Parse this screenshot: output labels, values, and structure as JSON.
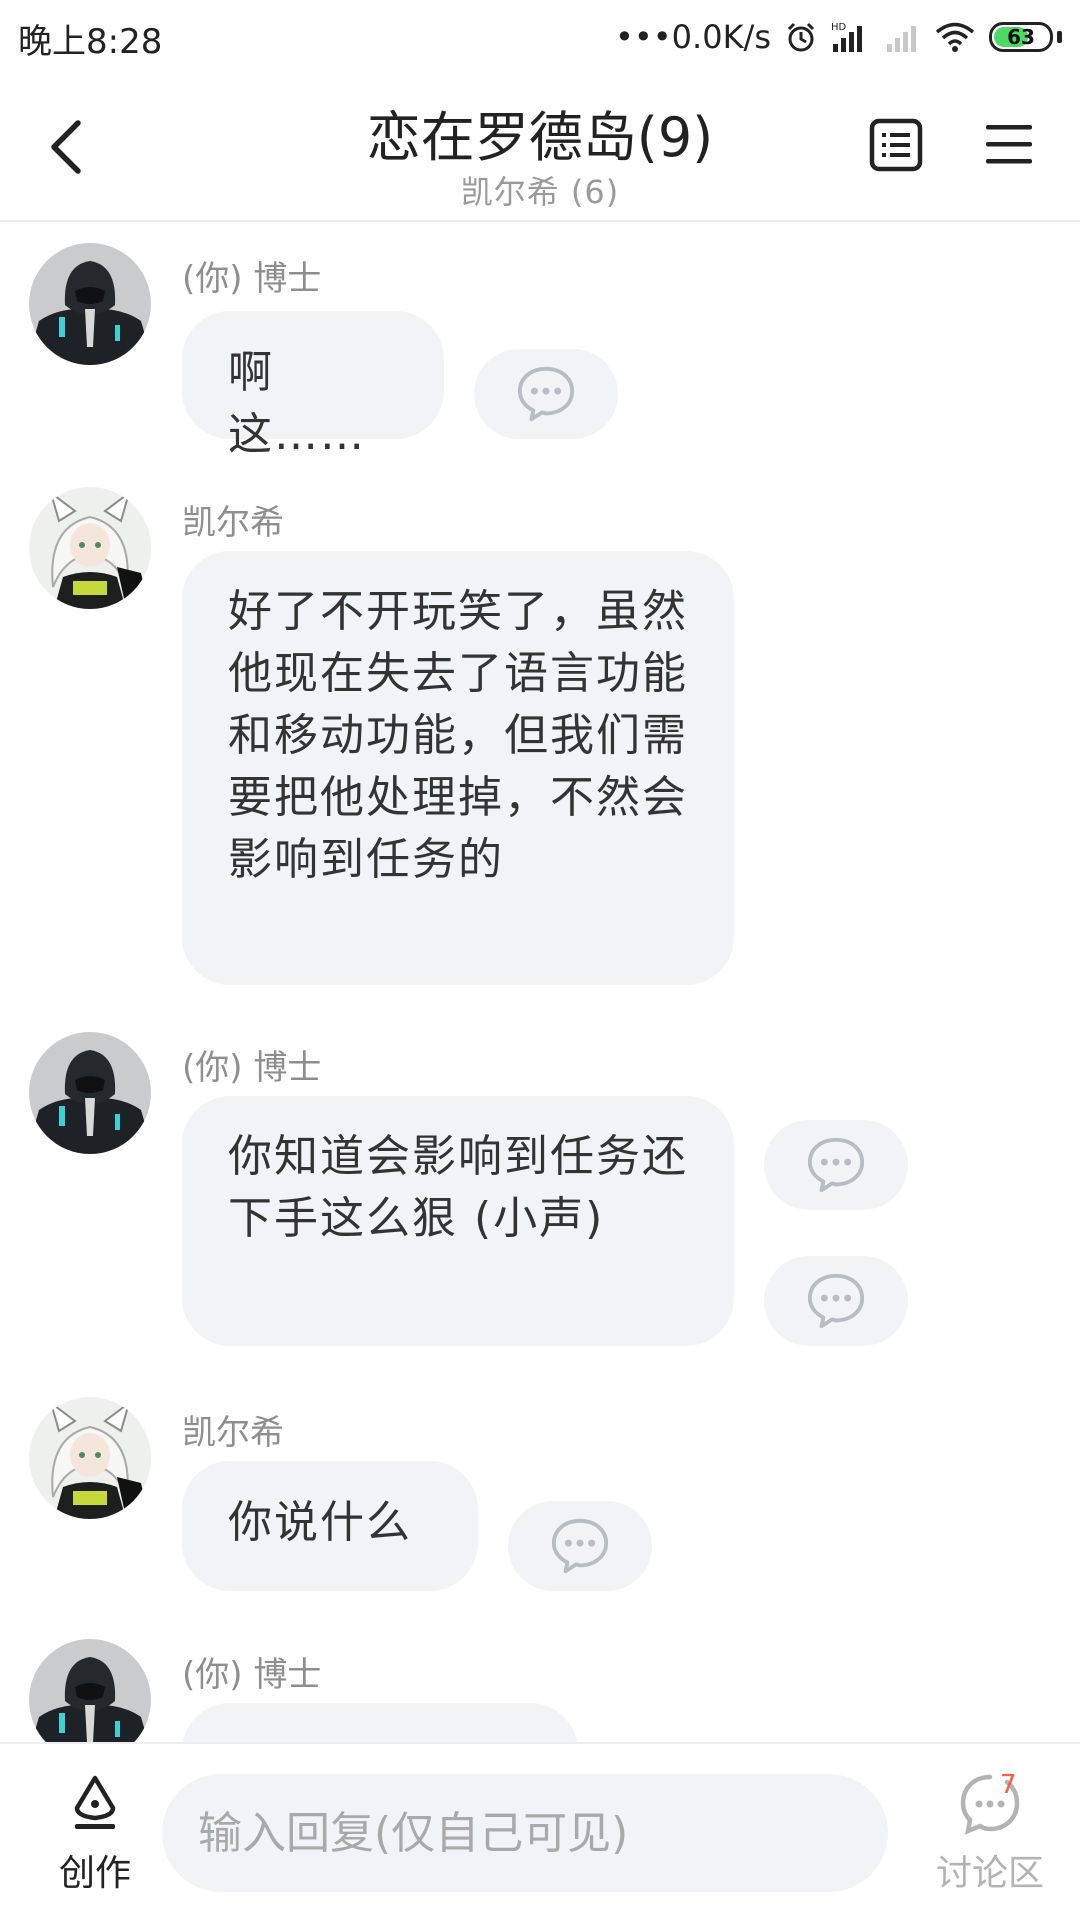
{
  "status_bar": {
    "time": "晚上8:28",
    "net_speed": "•••0.0K/s",
    "battery": "63",
    "icons": [
      "alarm-icon",
      "hd-signal-icon",
      "signal-off-icon",
      "wifi-icon",
      "battery-icon"
    ]
  },
  "header": {
    "title": "恋在罗德岛(9)",
    "subtitle": "凯尔希 (6)",
    "icons": [
      "back-icon",
      "list-icon",
      "menu-icon"
    ]
  },
  "messages": [
    {
      "sender": "(你) 博士",
      "text": "啊这……"
    },
    {
      "sender": "凯尔希",
      "text": "好了不开玩笑了，虽然他现在失去了语言功能和移动功能，但我们需要把他处理掉，不然会影响到任务的"
    },
    {
      "sender": "(你) 博士",
      "text": "你知道会影响到任务还下手这么狠 (小声)"
    },
    {
      "sender": "凯尔希",
      "text": "你说什么"
    },
    {
      "sender": "(你) 博士",
      "text": ""
    }
  ],
  "bottom_bar": {
    "create_label": "创作",
    "reply_placeholder": "输入回复(仅自己可见)",
    "discuss_label": "讨论区",
    "discuss_count": "7"
  },
  "colors": {
    "bubble": "#f2f3f7",
    "badge": "#ff5b45",
    "battery": "#4cd964"
  }
}
